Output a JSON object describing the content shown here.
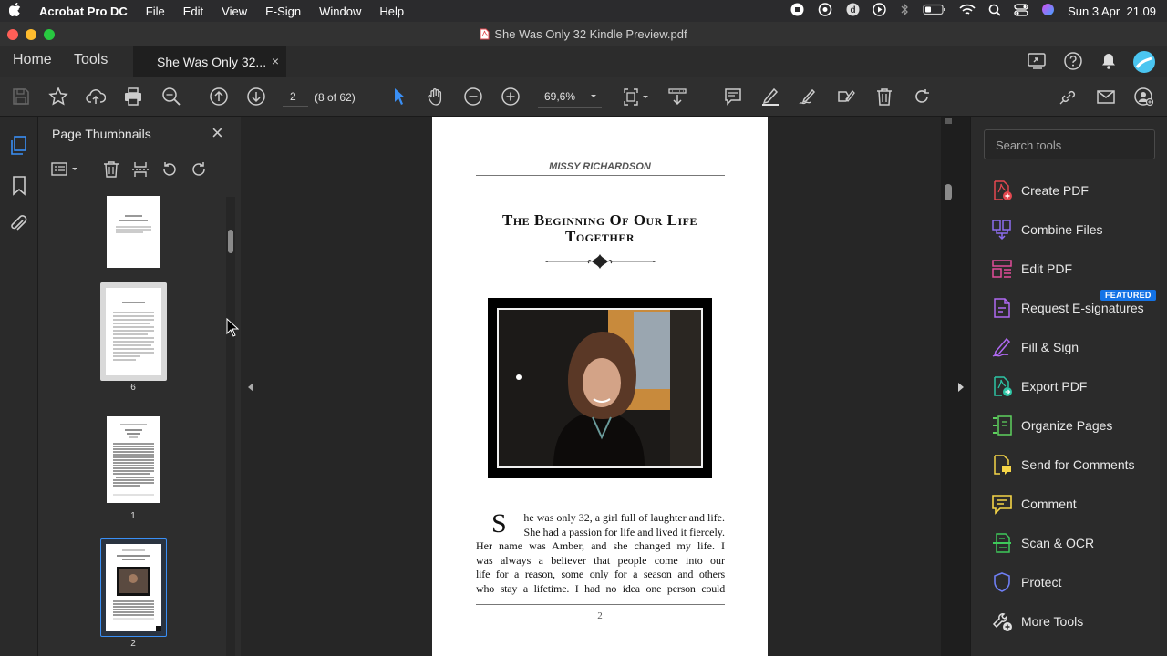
{
  "menubar": {
    "app": "Acrobat Pro DC",
    "items": [
      "File",
      "Edit",
      "View",
      "E-Sign",
      "Window",
      "Help"
    ],
    "datetime": "Sun 3 Apr  21.09"
  },
  "window": {
    "title": "She Was Only 32 Kindle Preview.pdf"
  },
  "tabs": {
    "home": "Home",
    "tools": "Tools",
    "document": "She Was Only 32...",
    "close": "×"
  },
  "toolbar": {
    "page_input": "2",
    "page_count": "(8 of 62)",
    "zoom": "69,6%"
  },
  "thumbnails": {
    "title": "Page Thumbnails",
    "close": "×",
    "pages": [
      {
        "label": ""
      },
      {
        "label": "6"
      },
      {
        "label": "1"
      },
      {
        "label": "2"
      }
    ]
  },
  "document_page": {
    "header": "MISSY RICHARDSON",
    "chapter_title_line1": "The Beginning Of Our Life",
    "chapter_title_line2": "Together",
    "drop_cap": "S",
    "para_line1": "he was only 32, a girl full of laughter and life.",
    "para_line2": "She had a passion for life and lived it fiercely.",
    "para_line3": "Her name was Amber, and she changed my life.  I",
    "para_line4": "was always a believer that people come into our",
    "para_line5": "life for a reason, some only for a season and others",
    "para_line6": "who stay a lifetime. I had no idea one person could",
    "page_number": "2"
  },
  "tools_pane": {
    "search_placeholder": "Search tools",
    "featured_badge": "FEATURED",
    "tools": [
      {
        "label": "Create PDF",
        "color": "#e34850"
      },
      {
        "label": "Combine Files",
        "color": "#8d6cf0"
      },
      {
        "label": "Edit PDF",
        "color": "#e34c9a"
      },
      {
        "label": "Request E-signatures",
        "color": "#b069f2"
      },
      {
        "label": "Fill & Sign",
        "color": "#b069f2"
      },
      {
        "label": "Export PDF",
        "color": "#2dc5a5"
      },
      {
        "label": "Organize Pages",
        "color": "#5ed15e"
      },
      {
        "label": "Send for Comments",
        "color": "#f5d547"
      },
      {
        "label": "Comment",
        "color": "#f5d547"
      },
      {
        "label": "Scan & OCR",
        "color": "#3ec95a"
      },
      {
        "label": "Protect",
        "color": "#6f7ff5"
      },
      {
        "label": "More Tools",
        "color": "#e0e0e0"
      }
    ]
  }
}
